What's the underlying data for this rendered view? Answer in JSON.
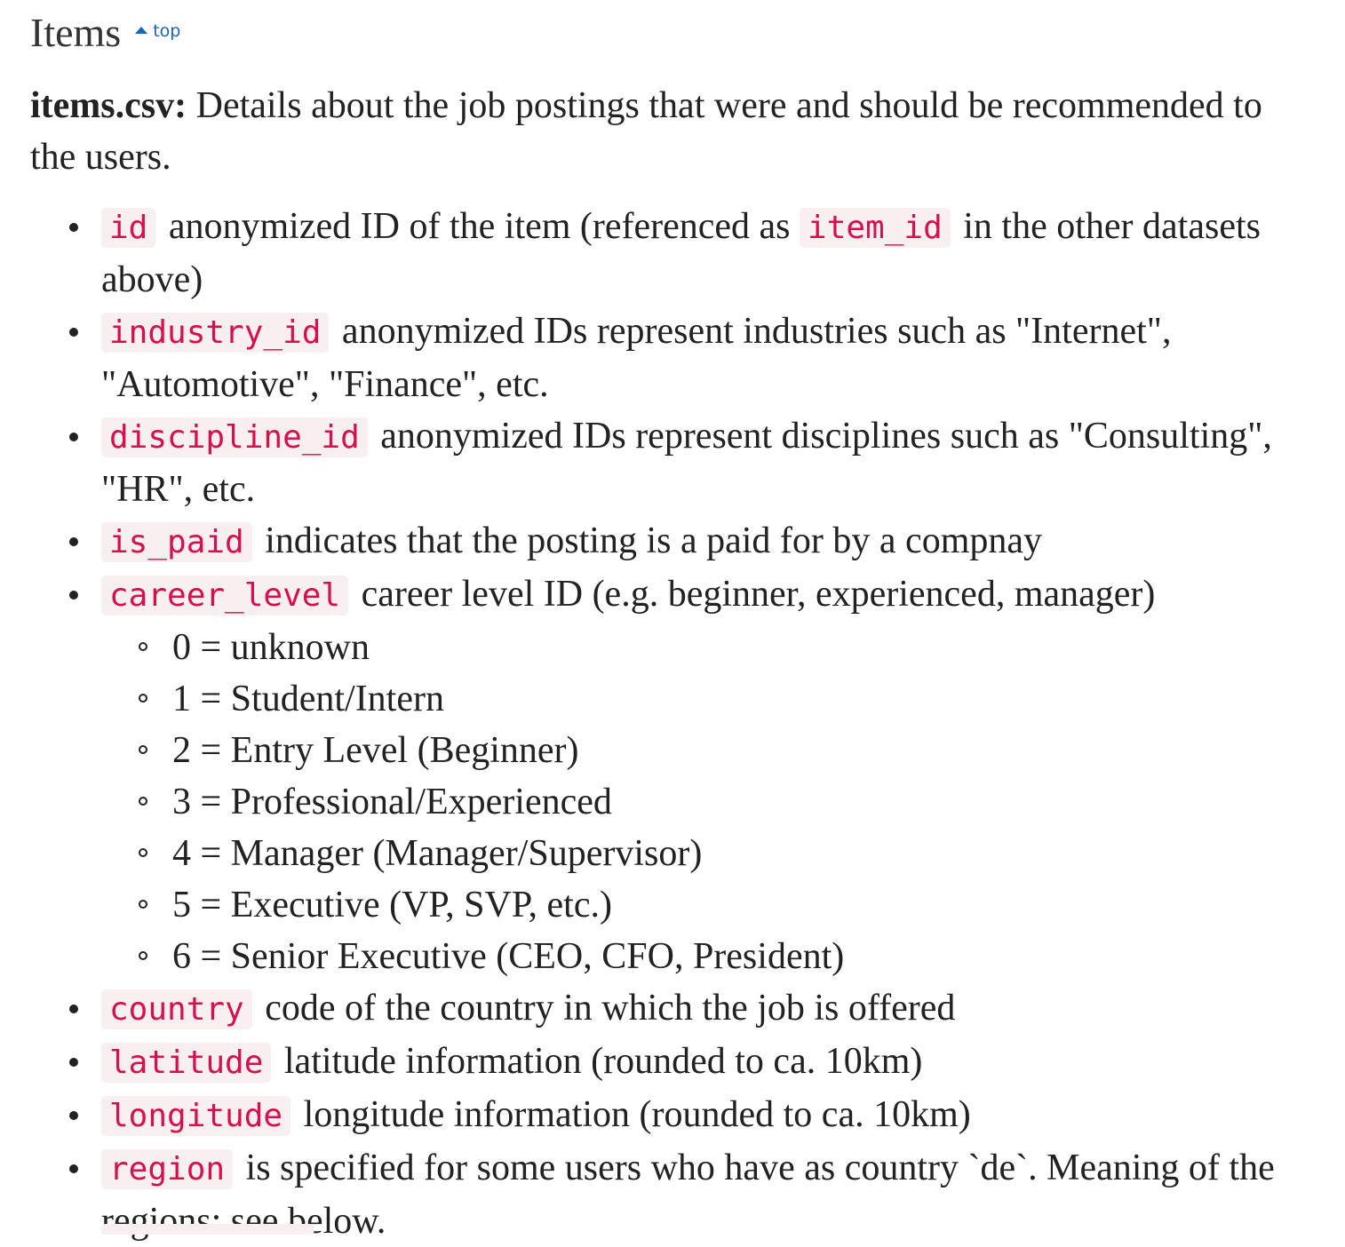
{
  "section": {
    "heading": "Items",
    "top_link": "top",
    "top_icon": "caret-up-icon"
  },
  "intro": {
    "filename": "items.csv:",
    "text": " Details about the job postings that were and should be recommended to the users."
  },
  "fields": [
    {
      "code": "id",
      "text_before": " anonymized ID of the item (referenced as ",
      "code2": "item_id",
      "text_after": " in the other datasets above)"
    },
    {
      "code": "industry_id",
      "text": " anonymized IDs represent industries such as \"Internet\", \"Automotive\", \"Finance\", etc."
    },
    {
      "code": "discipline_id",
      "text": " anonymized IDs represent disciplines such as \"Consulting\", \"HR\", etc."
    },
    {
      "code": "is_paid",
      "text": " indicates that the posting is a paid for by a compnay"
    },
    {
      "code": "career_level",
      "text": " career level ID (e.g. beginner, experienced, manager)"
    },
    {
      "code": "country",
      "text": " code of the country in which the job is offered"
    },
    {
      "code": "latitude",
      "text": " latitude information (rounded to ca. 10km)"
    },
    {
      "code": "longitude",
      "text": " longitude information (rounded to ca. 10km)"
    },
    {
      "code": "region",
      "text": " is specified for some users who have as country `de`. Meaning of the regions: see below."
    }
  ],
  "career_levels": [
    "0 = unknown",
    "1 = Student/Intern",
    "2 = Entry Level (Beginner)",
    "3 = Professional/Experienced",
    "4 = Manager (Manager/Supervisor)",
    "5 = Executive (VP, SVP, etc.)",
    "6 = Senior Executive (CEO, CFO, President)"
  ],
  "colors": {
    "code_text": "#d6104d",
    "code_bg": "#f8eff1",
    "link": "#1a64b8"
  }
}
